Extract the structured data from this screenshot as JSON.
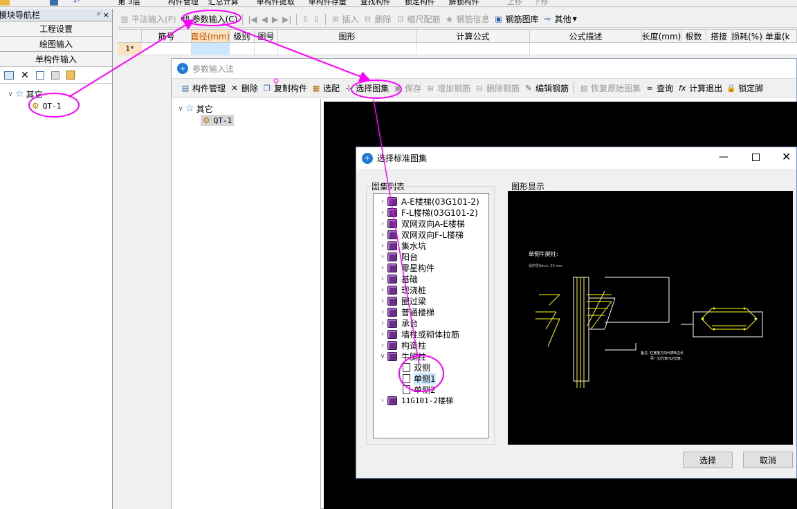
{
  "top_strip": {
    "items": [
      "第 3层",
      "构件管理",
      "汇总计算",
      "单构件提取",
      "单构件存量",
      "查找构件",
      "锁定构件",
      "解锁构件",
      "上移",
      "下移"
    ]
  },
  "nav": {
    "title": "模块导航栏",
    "pin": "ᵖ ×",
    "sections": [
      "工程设置",
      "绘图输入",
      "单构件输入"
    ],
    "tree_root": "其它",
    "tree_child": "QT-1"
  },
  "toolbar": {
    "flat_input": "平法输入(P)",
    "param_input": "参数输入(C)",
    "insert": "插入",
    "delete": "删除",
    "scale_rebar": "缩尺配筋",
    "rebar_info": "钢筋信息",
    "rebar_lib": "钢筋图库",
    "other": "其他"
  },
  "grid": {
    "columns": [
      "筋号",
      "直径(mm)",
      "级别",
      "图号",
      "图形",
      "计算公式",
      "公式描述",
      "长度(mm)",
      "根数",
      "搭接",
      "损耗(%)",
      "单重(k"
    ],
    "row1": "1*"
  },
  "param_dialog": {
    "title": "参数输入法",
    "tools": [
      "构件管理",
      "删除",
      "复制构件",
      "选配",
      "选择图集",
      "保存",
      "增加钢筋",
      "删除钢筋",
      "编辑钢筋",
      "恢复原始图集",
      "查询",
      "计算退出",
      "锁定脚"
    ],
    "tree_root": "其它",
    "tree_child": "QT-1"
  },
  "atlas_dialog": {
    "title": "选择标准图集",
    "list_title": "图集列表",
    "graphic_title": "图形显示",
    "items": [
      "A-E楼梯(03G101-2)",
      "F-L楼梯(03G101-2)",
      "双网双向A-E楼梯",
      "双网双向F-L楼梯",
      "集水坑",
      "阳台",
      "零星构件",
      "基础",
      "现浇桩",
      "圈过梁",
      "普通楼梯",
      "承台",
      "墙柱或砌体拉筋",
      "构造柱",
      "牛腿柱"
    ],
    "sub_items": [
      "双侧",
      "单侧1",
      "单侧2"
    ],
    "last_item": "11G101-2楼梯",
    "select_button": "选择",
    "cancel_button": "取消"
  },
  "drawing": {
    "heading": "单侧牛腿柱:",
    "cover": "保护层(bhc): 20 mm",
    "note1": "备注: 柱宽度方向代表B边长",
    "note2": "另一边代表H边长度。"
  },
  "colors": {
    "annotation": "#ff00ff",
    "selection": "#cce8ff",
    "cad_bg": "#000000"
  }
}
